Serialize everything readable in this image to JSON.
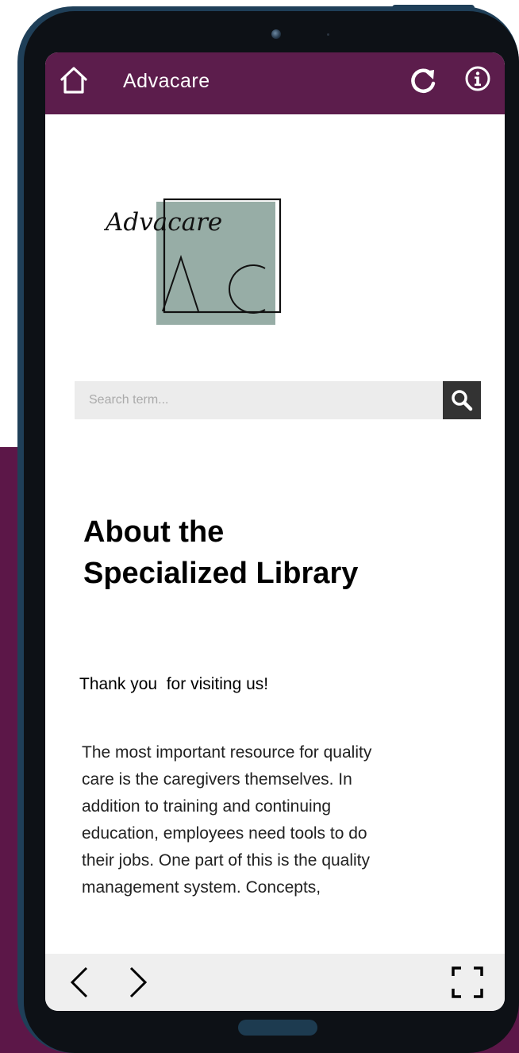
{
  "app": {
    "title": "Advacare",
    "accent_color": "#5c1d4c",
    "background_color": "#5c1748"
  },
  "topbar": {
    "home_icon": "home-icon",
    "refresh_icon": "refresh-icon",
    "info_icon": "info-icon"
  },
  "logo": {
    "script_text": "Advacare",
    "monogram": "AC",
    "tile_color": "#97ada6"
  },
  "search": {
    "placeholder": "Search term...",
    "value": "",
    "button_icon": "search-icon"
  },
  "main": {
    "heading_line1": "About the",
    "heading_line2": "Specialized Library",
    "thanks": "Thank you  for visiting us!",
    "body_lines": [
      "The most important resource for quality",
      "care is the caregivers themselves. In",
      "addition to training and continuing",
      "education, employees need tools to do",
      "their jobs. One part of this is the quality",
      "management system. Concepts,"
    ]
  },
  "bottombar": {
    "back_icon": "chevron-left-icon",
    "forward_icon": "chevron-right-icon",
    "fullscreen_icon": "fullscreen-icon"
  }
}
